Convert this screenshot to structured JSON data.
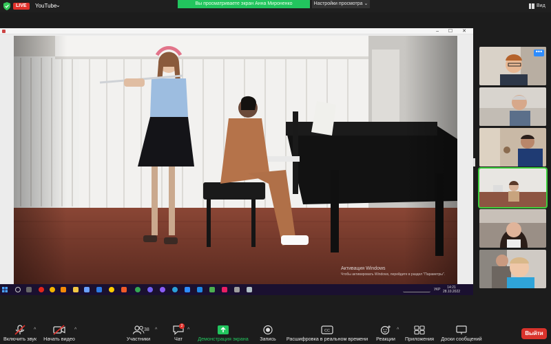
{
  "top_bar": {
    "live_badge": "LIVE",
    "source_app": "YouTube",
    "share_banner": "Вы просматриваете экран Анна Мироненко",
    "view_settings": "Настройки просмотра",
    "view_button": "Вид"
  },
  "video": {
    "watermark_title": "Активация Windows",
    "watermark_text": "Чтобы активировать Windows, перейдите в раздел \"Параметры\"."
  },
  "taskbar": {
    "language": "УКР",
    "time": "14:21",
    "date": "28.10.2022"
  },
  "participants_panel": {
    "more_button": "•••"
  },
  "toolbar": {
    "unmute": "Включить звук",
    "start_video": "Начать видео",
    "participants": "Участники",
    "participants_count": "38",
    "chat": "Чат",
    "chat_badge": "2",
    "share_screen": "Демонстрация экрана",
    "record": "Запись",
    "transcript": "Расшифровка в реальном времени",
    "reactions": "Реакции",
    "apps": "Приложения",
    "whiteboards": "Доски сообщений",
    "exit": "Выйти"
  },
  "colors": {
    "accent_green": "#22c55e",
    "exit_red": "#d9332c",
    "live_red": "#e0302a",
    "highlight_blue": "#2d8cff"
  }
}
